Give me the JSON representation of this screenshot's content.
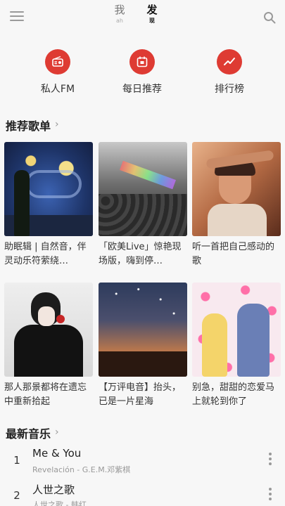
{
  "header": {
    "tabs": [
      {
        "label": "我",
        "sub": "ah"
      },
      {
        "label": "发",
        "sub": "现"
      }
    ]
  },
  "quick_entries": [
    {
      "label": "私人FM",
      "icon": "radio-icon"
    },
    {
      "label": "每日推荐",
      "icon": "calendar-icon"
    },
    {
      "label": "排行榜",
      "icon": "trend-chart-icon"
    }
  ],
  "sections": {
    "recommend_title": "推荐歌单",
    "new_music_title": "最新音乐"
  },
  "playlists": [
    {
      "caption": "助眠辑 | 自然音，伴灵动乐符萦绕…"
    },
    {
      "caption": "「欧美Live」惊艳现场版，嗨到停…"
    },
    {
      "caption": "听一首把自己感动的歌"
    },
    {
      "caption": "那人那景都将在遗忘中重新拾起"
    },
    {
      "caption": "【万评电音】抬头，已是一片星海"
    },
    {
      "caption": "别急，甜甜的恋爱马上就轮到你了"
    }
  ],
  "songs": [
    {
      "num": "1",
      "title": "Me & You",
      "sub": "Revelación - G.E.M.邓紫棋"
    },
    {
      "num": "2",
      "title": "人世之歌",
      "sub": "人世之歌 - 韩红"
    }
  ],
  "colors": {
    "accent": "#de3b33",
    "background": "#f7f7f7"
  }
}
